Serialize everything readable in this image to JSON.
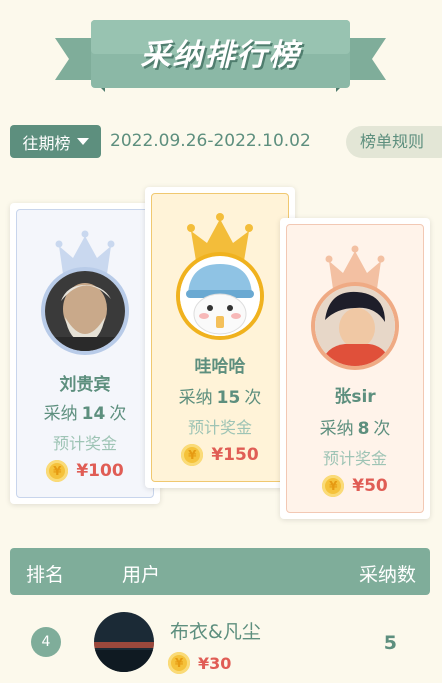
{
  "banner": {
    "title": "采纳排行榜"
  },
  "filter": {
    "period_label": "往期榜",
    "date_range": "2022.09.26-2022.10.02",
    "rules_label": "榜单规则"
  },
  "podium": [
    {
      "rank": 2,
      "name": "刘贵宾",
      "count_prefix": "采纳",
      "count": "14",
      "count_suffix": "次",
      "prize_label": "预计奖金",
      "prize": "¥100"
    },
    {
      "rank": 1,
      "name": "哇哈哈",
      "count_prefix": "采纳",
      "count": "15",
      "count_suffix": "次",
      "prize_label": "预计奖金",
      "prize": "¥150"
    },
    {
      "rank": 3,
      "name": "张sir",
      "count_prefix": "采纳",
      "count": "8",
      "count_suffix": "次",
      "prize_label": "预计奖金",
      "prize": "¥50"
    }
  ],
  "table": {
    "headers": {
      "rank": "排名",
      "user": "用户",
      "count": "采纳数"
    },
    "rows": [
      {
        "rank": "4",
        "name": "布衣&凡尘",
        "prize": "¥30",
        "count": "5"
      }
    ]
  },
  "coin_symbol": "¥",
  "colors": {
    "accent": "#5d8f7e",
    "banner": "#7fad9a",
    "prize": "#e05d55",
    "gold": "#f0b21e"
  }
}
